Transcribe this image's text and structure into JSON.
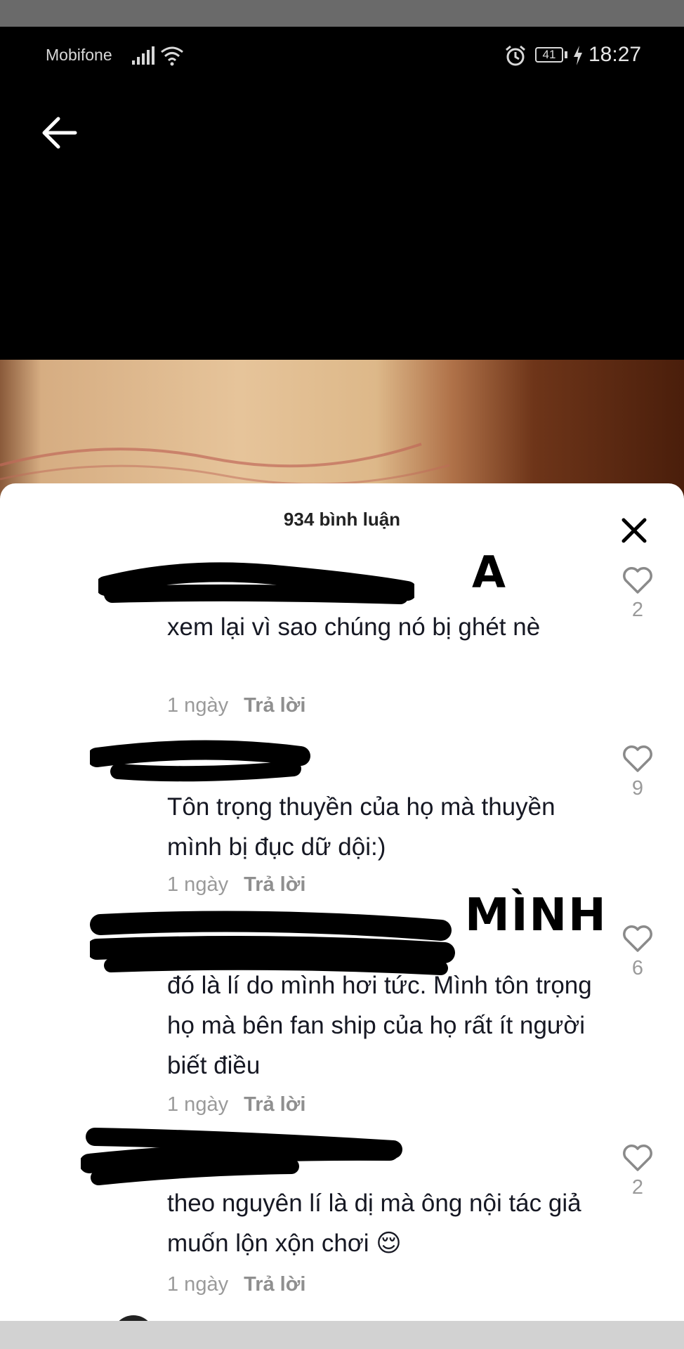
{
  "status_bar": {
    "carrier": "Mobifone",
    "battery_level": "41",
    "time": "18:27"
  },
  "comments_sheet": {
    "title": "934 bình luận",
    "comments": [
      {
        "text": "xem lại vì sao chúng nó bị ghét nè",
        "time": "1 ngày",
        "reply_label": "Trả lời",
        "likes": "2",
        "annotation": "A"
      },
      {
        "text": "Tôn trọng thuyền của họ mà thuyền mình bị đục dữ dội:)",
        "time": "1 ngày",
        "reply_label": "Trả lời",
        "likes": "9"
      },
      {
        "text": "đó là lí do mình hơi tức. Mình tôn trọng họ mà bên fan ship của họ rất ít người biết điều",
        "time": "1 ngày",
        "reply_label": "Trả lời",
        "likes": "6",
        "annotation": "MÌNH"
      },
      {
        "text": "theo nguyên lí là dị mà ông nội tác giả muốn lộn xộn chơi 😌",
        "time": "1 ngày",
        "reply_label": "Trả lời",
        "likes": "2"
      }
    ]
  }
}
